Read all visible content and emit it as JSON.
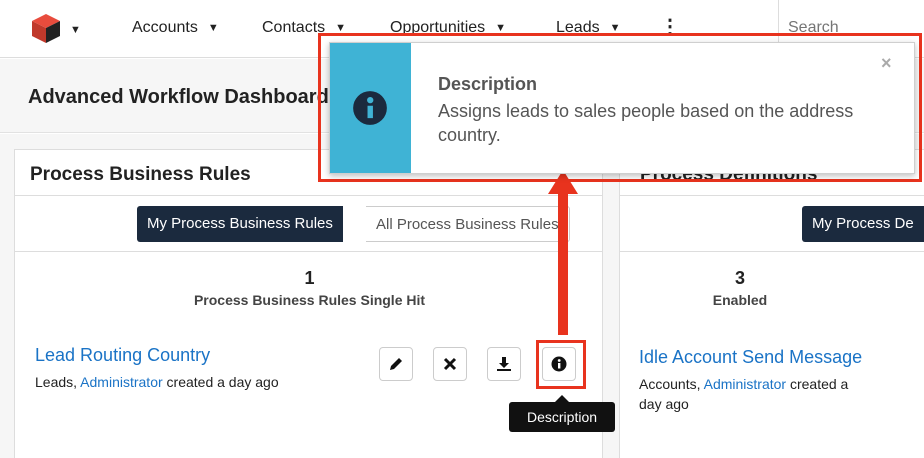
{
  "nav": {
    "items": [
      {
        "label": "Accounts"
      },
      {
        "label": "Contacts"
      },
      {
        "label": "Opportunities"
      },
      {
        "label": "Leads"
      }
    ],
    "search_placeholder": "Search",
    "caret": "▼",
    "kebab": "⋮"
  },
  "page": {
    "title": "Advanced Workflow Dashboard"
  },
  "left_dashlet": {
    "title": "Process Business Rules",
    "tabs": [
      {
        "label": "My Process Business Rules",
        "active": true
      },
      {
        "label": "All Process Business Rules",
        "active": false
      }
    ],
    "count": "1",
    "count_label": "Process Business Rules Single Hit",
    "record": {
      "name": "Lead Routing Country",
      "module": "Leads,",
      "user": "Administrator",
      "action": "created a day ago"
    },
    "actions": [
      {
        "icon": "pencil-icon",
        "label": "Edit"
      },
      {
        "icon": "x-icon",
        "label": "Delete"
      },
      {
        "icon": "download-icon",
        "label": "Export"
      },
      {
        "icon": "info-icon",
        "label": "Description"
      }
    ],
    "tooltip": "Description"
  },
  "right_dashlet": {
    "title": "Process Definitions",
    "tabs": [
      {
        "label": "My Process De",
        "active": true
      }
    ],
    "count": "3",
    "count_label": "Enabled",
    "record": {
      "name": "Idle Account Send Message",
      "module": "Accounts,",
      "user": "Administrator",
      "action_line1": "created a",
      "action_line2": "day ago"
    }
  },
  "popup": {
    "title": "Description",
    "text": "Assigns leads to sales people based on the address country.",
    "close": "×"
  },
  "colors": {
    "accent_red": "#e8331e",
    "info_blue": "#3fb3d5",
    "link_blue": "#1a73c6",
    "active_tab": "#1b2a3e"
  }
}
